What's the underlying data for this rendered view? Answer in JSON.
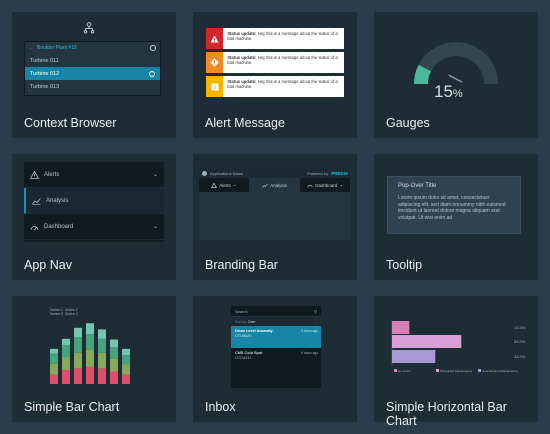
{
  "cards": [
    {
      "title": "Context Browser"
    },
    {
      "title": "Alert Message"
    },
    {
      "title": "Gauges"
    },
    {
      "title": "App Nav"
    },
    {
      "title": "Branding Bar"
    },
    {
      "title": "Tooltip"
    },
    {
      "title": "Simple Bar Chart"
    },
    {
      "title": "Inbox"
    },
    {
      "title": "Simple Horizontal Bar Chart"
    }
  ],
  "context_browser": {
    "header": "Boulder Plant #15",
    "items": [
      "Turbine 011",
      "Turbine 012",
      "Turbine 013"
    ],
    "selected_index": 1
  },
  "alerts": [
    {
      "bold": "Status update:",
      "text": "Hey this is a message about the status of a bad machine.",
      "color": "#d0262d",
      "icon": "warning-icon"
    },
    {
      "bold": "Status update:",
      "text": "Hey this is a message about the status of a bad machine.",
      "color": "#f08a24",
      "icon": "warning-icon"
    },
    {
      "bold": "Status update:",
      "text": "Hey this is a message about the status of a bad machine.",
      "color": "#f4b400",
      "icon": "info-icon"
    }
  ],
  "gauge": {
    "value": "15",
    "unit": "%",
    "fraction": 0.15,
    "accent": "#4cb89e"
  },
  "app_nav": {
    "items": [
      "Alerts",
      "Analysis",
      "Dashboard"
    ]
  },
  "branding_bar": {
    "app_name": "Applications Name",
    "powered_by": "Powered by",
    "brand": "PREDIX",
    "tabs": [
      "Alerts",
      "Analysis",
      "Dashboard"
    ]
  },
  "tooltip": {
    "title": "Pop-Over Title",
    "body": "Lorem ipsum dolor sit amet, consectetuer adipiscing elit, sed diam nonummy nibh euismod tincidunt ut laoreet dolore magna aliquam erat volutpat. Ut wisi enim ad"
  },
  "chart_data": [
    {
      "type": "bar",
      "stacked": true,
      "categories": [
        "",
        "",
        "",
        "",
        "",
        "",
        ""
      ],
      "series": [
        {
          "values": [
            12,
            18,
            20,
            22,
            20,
            16,
            12
          ],
          "color": "#e04d6b"
        },
        {
          "values": [
            14,
            16,
            20,
            22,
            20,
            17,
            13
          ],
          "color": "#8aa85a"
        },
        {
          "values": [
            13,
            16,
            20,
            20,
            18,
            14,
            12
          ],
          "color": "#45a47d"
        },
        {
          "values": [
            6,
            8,
            12,
            14,
            12,
            10,
            8
          ],
          "color": "#74c5b0"
        }
      ],
      "legend": [
        "Series 1",
        "Series 2",
        "Series 3",
        "Series 4"
      ]
    },
    {
      "type": "bar",
      "orientation": "horizontal",
      "categories": [
        "",
        "",
        ""
      ],
      "values": [
        13.3,
        53.3,
        33.3
      ],
      "labels": [
        "13.3%",
        "53.3%",
        "33.3%"
      ],
      "colors": [
        "#d680b5",
        "#d79fd6",
        "#a699d6"
      ],
      "legend": [
        "No Action",
        "Scheduled Maintenance",
        "Unscheduled Maintenance"
      ]
    }
  ],
  "inbox": {
    "search_placeholder": "Search",
    "sort_label": "Sort by:",
    "sort_value": "Date",
    "items": [
      {
        "title": "Drum Level Anomaly",
        "sub": "UTO8420",
        "date": "3 hours ago"
      },
      {
        "title": "CMS Cold Spot",
        "sub": "UTO4431",
        "date": "6 hours ago"
      }
    ],
    "selected_index": 0
  }
}
